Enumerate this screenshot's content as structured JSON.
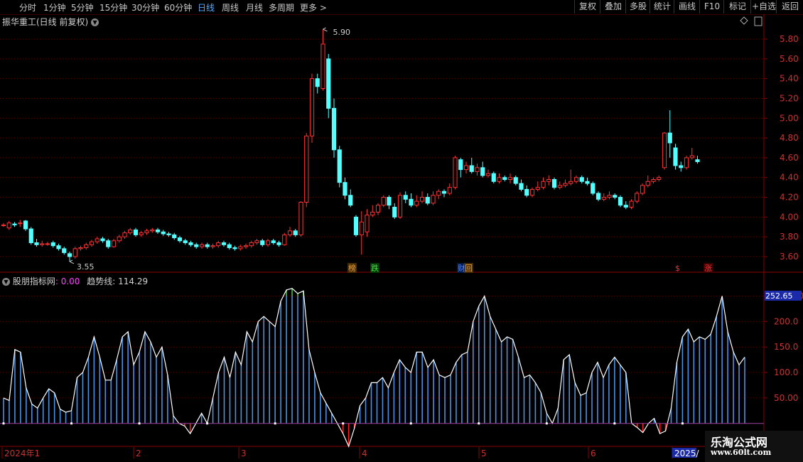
{
  "toolbar": {
    "periods": [
      "分时",
      "1分钟",
      "5分钟",
      "15分钟",
      "30分钟",
      "60分钟",
      "日线",
      "周线",
      "月线",
      "多周期",
      "更多 >"
    ],
    "active_period": "日线",
    "right_buttons": [
      "复权",
      "叠加",
      "多股",
      "统计",
      "画线",
      "F10",
      "标记",
      "+自选",
      "返回"
    ]
  },
  "main_chart": {
    "title": "振华重工(日线 前复权)",
    "price_axis": [
      "5.80",
      "5.60",
      "5.40",
      "5.20",
      "5.00",
      "4.80",
      "4.60",
      "4.40",
      "4.20",
      "4.00",
      "3.80",
      "3.60"
    ],
    "high_label": "5.90",
    "low_label": "3.55",
    "markers": [
      "榜",
      "跌",
      "财",
      "回",
      "$",
      "涨"
    ]
  },
  "indicator": {
    "title": "股朋指标网",
    "title_value": ": 0.00",
    "trend_label": "趋势线: 114.29",
    "axis": [
      "250.00",
      "200.0",
      "150.0",
      "100.0",
      "50.00"
    ],
    "current_badge": "252.65"
  },
  "time_axis": [
    "2024年1",
    "2",
    "3",
    "4",
    "5",
    "6",
    "2025/"
  ],
  "watermark": {
    "line1": "乐淘公式网",
    "line2": "www.60lt.com"
  },
  "colors": {
    "up": "#ff3232",
    "down": "#54ffff",
    "indicator_bar": "#4f8fdc",
    "trend": "#ffffff",
    "active": "#5aa8ff"
  },
  "chart_data": {
    "type": "candlestick",
    "ylim": [
      -45,
      280
    ],
    "candles": [
      [
        3.92,
        3.92,
        3.9,
        3.94
      ],
      [
        3.89,
        3.94,
        3.87,
        3.96
      ],
      [
        3.93,
        3.92,
        3.9,
        3.95
      ],
      [
        3.94,
        3.94,
        3.9,
        3.97
      ],
      [
        3.96,
        3.88,
        3.86,
        3.97
      ],
      [
        3.88,
        3.74,
        3.72,
        3.9
      ],
      [
        3.74,
        3.72,
        3.7,
        3.78
      ],
      [
        3.72,
        3.73,
        3.7,
        3.76
      ],
      [
        3.73,
        3.73,
        3.71,
        3.75
      ],
      [
        3.74,
        3.71,
        3.69,
        3.76
      ],
      [
        3.71,
        3.68,
        3.66,
        3.73
      ],
      [
        3.68,
        3.64,
        3.62,
        3.7
      ],
      [
        3.63,
        3.6,
        3.55,
        3.65
      ],
      [
        3.6,
        3.68,
        3.58,
        3.7
      ],
      [
        3.68,
        3.69,
        3.66,
        3.71
      ],
      [
        3.69,
        3.72,
        3.67,
        3.74
      ],
      [
        3.72,
        3.75,
        3.7,
        3.77
      ],
      [
        3.75,
        3.78,
        3.73,
        3.8
      ],
      [
        3.78,
        3.76,
        3.74,
        3.8
      ],
      [
        3.76,
        3.7,
        3.68,
        3.78
      ],
      [
        3.7,
        3.76,
        3.69,
        3.78
      ],
      [
        3.76,
        3.8,
        3.74,
        3.82
      ],
      [
        3.8,
        3.84,
        3.78,
        3.86
      ],
      [
        3.84,
        3.87,
        3.82,
        3.89
      ],
      [
        3.87,
        3.82,
        3.8,
        3.89
      ],
      [
        3.82,
        3.84,
        3.8,
        3.86
      ],
      [
        3.84,
        3.86,
        3.82,
        3.88
      ],
      [
        3.86,
        3.87,
        3.84,
        3.89
      ],
      [
        3.87,
        3.85,
        3.83,
        3.89
      ],
      [
        3.85,
        3.83,
        3.81,
        3.87
      ],
      [
        3.83,
        3.82,
        3.8,
        3.85
      ],
      [
        3.82,
        3.79,
        3.77,
        3.84
      ],
      [
        3.79,
        3.76,
        3.74,
        3.81
      ],
      [
        3.76,
        3.74,
        3.72,
        3.78
      ],
      [
        3.74,
        3.72,
        3.7,
        3.76
      ],
      [
        3.72,
        3.7,
        3.68,
        3.74
      ],
      [
        3.7,
        3.72,
        3.68,
        3.74
      ],
      [
        3.72,
        3.7,
        3.68,
        3.74
      ],
      [
        3.7,
        3.71,
        3.68,
        3.73
      ],
      [
        3.71,
        3.74,
        3.69,
        3.76
      ],
      [
        3.74,
        3.72,
        3.7,
        3.76
      ],
      [
        3.72,
        3.69,
        3.67,
        3.74
      ],
      [
        3.69,
        3.68,
        3.66,
        3.71
      ],
      [
        3.68,
        3.7,
        3.66,
        3.72
      ],
      [
        3.7,
        3.71,
        3.68,
        3.73
      ],
      [
        3.71,
        3.74,
        3.69,
        3.76
      ],
      [
        3.74,
        3.76,
        3.72,
        3.78
      ],
      [
        3.76,
        3.72,
        3.7,
        3.78
      ],
      [
        3.72,
        3.76,
        3.7,
        3.78
      ],
      [
        3.76,
        3.74,
        3.72,
        3.78
      ],
      [
        3.74,
        3.72,
        3.7,
        3.76
      ],
      [
        3.72,
        3.82,
        3.71,
        3.84
      ],
      [
        3.82,
        3.86,
        3.8,
        3.9
      ],
      [
        3.86,
        3.82,
        3.8,
        3.88
      ],
      [
        3.82,
        4.15,
        3.8,
        4.16
      ],
      [
        4.15,
        4.82,
        4.1,
        4.85
      ],
      [
        4.82,
        5.4,
        4.75,
        5.45
      ],
      [
        5.4,
        5.32,
        5.25,
        5.45
      ],
      [
        5.3,
        5.75,
        5.28,
        5.9
      ],
      [
        5.6,
        5.1,
        5.0,
        5.65
      ],
      [
        5.1,
        4.68,
        4.6,
        5.2
      ],
      [
        4.68,
        4.35,
        4.3,
        4.72
      ],
      [
        4.35,
        4.22,
        4.18,
        4.4
      ],
      [
        4.22,
        4.12,
        4.1,
        4.28
      ],
      [
        4.0,
        3.82,
        3.8,
        4.02
      ],
      [
        3.82,
        3.95,
        3.62,
        4.06
      ],
      [
        3.85,
        4.02,
        3.8,
        4.08
      ],
      [
        4.02,
        4.05,
        4.0,
        4.12
      ],
      [
        4.05,
        4.12,
        4.02,
        4.14
      ],
      [
        4.12,
        4.2,
        4.1,
        4.22
      ],
      [
        4.2,
        4.12,
        4.08,
        4.22
      ],
      [
        4.1,
        4.0,
        3.98,
        4.14
      ],
      [
        4.0,
        4.22,
        3.98,
        4.25
      ],
      [
        4.22,
        4.18,
        4.14,
        4.26
      ],
      [
        4.18,
        4.12,
        4.1,
        4.24
      ],
      [
        4.12,
        4.16,
        4.1,
        4.22
      ],
      [
        4.16,
        4.2,
        4.14,
        4.26
      ],
      [
        4.2,
        4.14,
        4.12,
        4.24
      ],
      [
        4.14,
        4.22,
        4.12,
        4.26
      ],
      [
        4.22,
        4.26,
        4.18,
        4.28
      ],
      [
        4.26,
        4.24,
        4.2,
        4.28
      ],
      [
        4.24,
        4.3,
        4.22,
        4.34
      ],
      [
        4.3,
        4.6,
        4.28,
        4.62
      ],
      [
        4.58,
        4.48,
        4.4,
        4.6
      ],
      [
        4.48,
        4.52,
        4.44,
        4.56
      ],
      [
        4.52,
        4.46,
        4.44,
        4.6
      ],
      [
        4.46,
        4.5,
        4.42,
        4.54
      ],
      [
        4.5,
        4.42,
        4.4,
        4.56
      ],
      [
        4.42,
        4.44,
        4.4,
        4.48
      ],
      [
        4.44,
        4.36,
        4.34,
        4.46
      ],
      [
        4.36,
        4.4,
        4.34,
        4.44
      ],
      [
        4.4,
        4.38,
        4.36,
        4.42
      ],
      [
        4.38,
        4.4,
        4.34,
        4.44
      ],
      [
        4.4,
        4.34,
        4.32,
        4.42
      ],
      [
        4.34,
        4.28,
        4.26,
        4.38
      ],
      [
        4.28,
        4.22,
        4.2,
        4.32
      ],
      [
        4.22,
        4.28,
        4.2,
        4.3
      ],
      [
        4.28,
        4.3,
        4.26,
        4.36
      ],
      [
        4.3,
        4.36,
        4.28,
        4.4
      ],
      [
        4.36,
        4.38,
        4.32,
        4.42
      ],
      [
        4.38,
        4.3,
        4.28,
        4.4
      ],
      [
        4.3,
        4.32,
        4.28,
        4.36
      ],
      [
        4.32,
        4.34,
        4.3,
        4.38
      ],
      [
        4.34,
        4.36,
        4.32,
        4.48
      ],
      [
        4.36,
        4.4,
        4.34,
        4.42
      ],
      [
        4.4,
        4.36,
        4.34,
        4.42
      ],
      [
        4.36,
        4.34,
        4.32,
        4.4
      ],
      [
        4.34,
        4.24,
        4.22,
        4.36
      ],
      [
        4.24,
        4.18,
        4.16,
        4.26
      ],
      [
        4.18,
        4.2,
        4.16,
        4.24
      ],
      [
        4.2,
        4.22,
        4.18,
        4.26
      ],
      [
        4.22,
        4.2,
        4.18,
        4.24
      ],
      [
        4.2,
        4.12,
        4.1,
        4.22
      ],
      [
        4.12,
        4.1,
        4.08,
        4.16
      ],
      [
        4.1,
        4.16,
        4.08,
        4.18
      ],
      [
        4.16,
        4.24,
        4.14,
        4.26
      ],
      [
        4.24,
        4.32,
        4.22,
        4.34
      ],
      [
        4.32,
        4.36,
        4.3,
        4.42
      ],
      [
        4.36,
        4.38,
        4.34,
        4.4
      ],
      [
        4.38,
        4.4,
        4.36,
        4.42
      ],
      [
        4.5,
        4.85,
        4.48,
        4.86
      ],
      [
        4.85,
        4.75,
        4.6,
        5.08
      ],
      [
        4.7,
        4.52,
        4.48,
        4.74
      ],
      [
        4.52,
        4.5,
        4.46,
        4.56
      ],
      [
        4.5,
        4.6,
        4.48,
        4.62
      ],
      [
        4.6,
        4.62,
        4.58,
        4.7
      ],
      [
        4.58,
        4.56,
        4.54,
        4.62
      ]
    ],
    "indicator_values": [
      50,
      45,
      145,
      140,
      70,
      38,
      30,
      50,
      68,
      60,
      28,
      22,
      25,
      90,
      100,
      130,
      170,
      130,
      85,
      85,
      125,
      170,
      180,
      115,
      140,
      180,
      160,
      130,
      150,
      95,
      15,
      0,
      -5,
      -20,
      0,
      20,
      0,
      50,
      100,
      130,
      90,
      140,
      115,
      180,
      160,
      200,
      210,
      200,
      190,
      240,
      262,
      265,
      255,
      260,
      145,
      100,
      60,
      40,
      20,
      0,
      -20,
      -45,
      -10,
      35,
      50,
      80,
      80,
      90,
      70,
      100,
      125,
      110,
      100,
      140,
      140,
      110,
      125,
      95,
      90,
      95,
      120,
      135,
      140,
      200,
      230,
      250,
      210,
      185,
      160,
      170,
      165,
      130,
      90,
      95,
      80,
      60,
      20,
      0,
      30,
      125,
      135,
      80,
      55,
      60,
      100,
      120,
      90,
      115,
      130,
      115,
      100,
      0,
      -8,
      -18,
      0,
      10,
      -20,
      -15,
      30,
      120,
      170,
      185,
      160,
      170,
      165,
      175,
      210,
      250,
      180,
      140,
      115,
      130
    ],
    "trend_line": "white",
    "overbought_threshold": 250
  }
}
